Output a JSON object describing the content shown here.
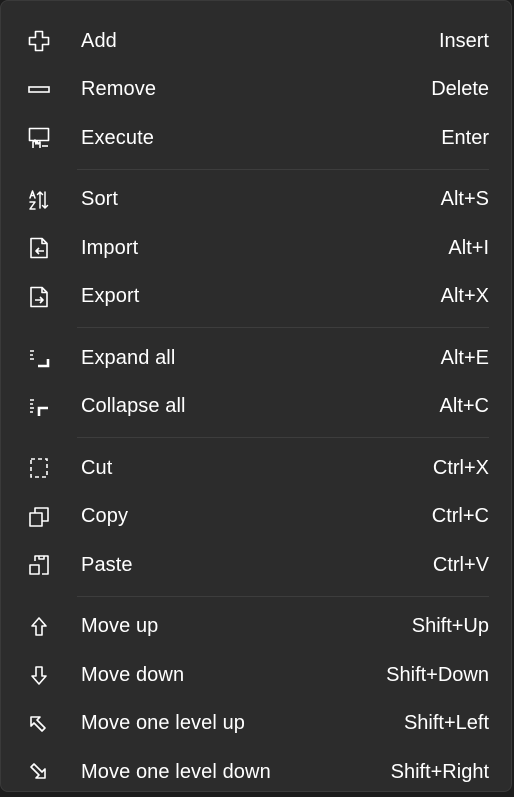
{
  "menu": {
    "groups": [
      {
        "items": [
          {
            "label": "Add",
            "shortcut": "Insert",
            "icon": "add-icon"
          },
          {
            "label": "Remove",
            "shortcut": "Delete",
            "icon": "remove-icon"
          },
          {
            "label": "Execute",
            "shortcut": "Enter",
            "icon": "execute-icon"
          }
        ]
      },
      {
        "items": [
          {
            "label": "Sort",
            "shortcut": "Alt+S",
            "icon": "sort-icon"
          },
          {
            "label": "Import",
            "shortcut": "Alt+I",
            "icon": "import-icon"
          },
          {
            "label": "Export",
            "shortcut": "Alt+X",
            "icon": "export-icon"
          }
        ]
      },
      {
        "items": [
          {
            "label": "Expand all",
            "shortcut": "Alt+E",
            "icon": "expand-all-icon"
          },
          {
            "label": "Collapse all",
            "shortcut": "Alt+C",
            "icon": "collapse-all-icon"
          }
        ]
      },
      {
        "items": [
          {
            "label": "Cut",
            "shortcut": "Ctrl+X",
            "icon": "cut-icon"
          },
          {
            "label": "Copy",
            "shortcut": "Ctrl+C",
            "icon": "copy-icon"
          },
          {
            "label": "Paste",
            "shortcut": "Ctrl+V",
            "icon": "paste-icon"
          }
        ]
      },
      {
        "items": [
          {
            "label": "Move up",
            "shortcut": "Shift+Up",
            "icon": "move-up-icon"
          },
          {
            "label": "Move down",
            "shortcut": "Shift+Down",
            "icon": "move-down-icon"
          },
          {
            "label": "Move one level up",
            "shortcut": "Shift+Left",
            "icon": "move-level-up-icon"
          },
          {
            "label": "Move one level down",
            "shortcut": "Shift+Right",
            "icon": "move-level-down-icon"
          }
        ]
      }
    ]
  },
  "colors": {
    "menu_background": "#2c2c2c",
    "text": "#ffffff",
    "separator": "#3d3d3d"
  }
}
